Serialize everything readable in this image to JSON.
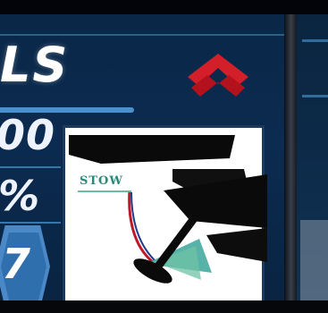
{
  "header": {
    "title": "LS",
    "logo_icon": "red-chevron-logo-icon"
  },
  "readouts": {
    "value_primary": "00",
    "value_percent": "%",
    "badge_value": "7"
  },
  "diagram": {
    "position_label": "STOW"
  },
  "colors": {
    "background": "#0b2b50",
    "accent_blue": "#4f95d2",
    "logo_red": "#d21f2a",
    "stow_green": "#2a8a7a"
  }
}
